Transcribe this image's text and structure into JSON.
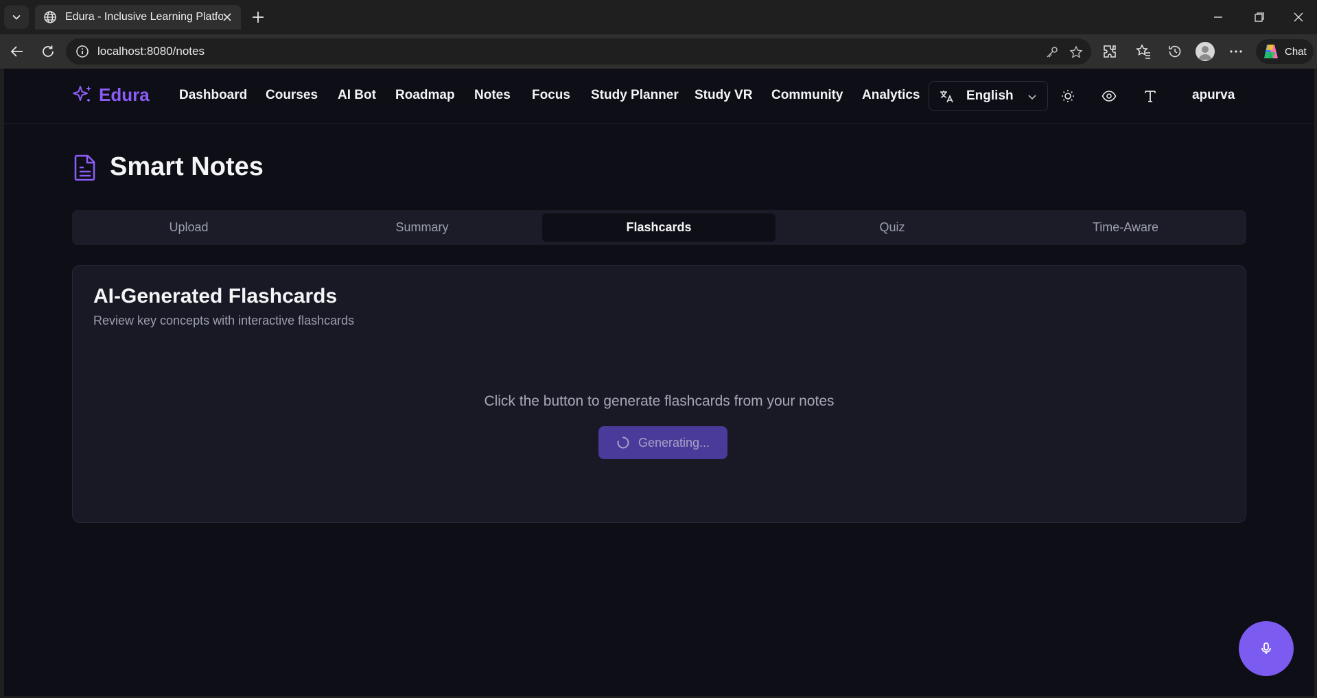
{
  "browser": {
    "tab_title": "Edura - Inclusive Learning Platform",
    "url": "localhost:8080/notes",
    "chat_label": "Chat"
  },
  "header": {
    "logo_text": "Edura",
    "nav": [
      "Dashboard",
      "Courses",
      "AI Bot",
      "Roadmap",
      "Notes",
      "Focus",
      "Study Planner",
      "Study VR",
      "Community",
      "Analytics"
    ],
    "language": "English",
    "user": "apurva"
  },
  "page": {
    "title": "Smart Notes",
    "tabs": [
      "Upload",
      "Summary",
      "Flashcards",
      "Quiz",
      "Time-Aware"
    ],
    "active_tab": "Flashcards"
  },
  "card": {
    "title": "AI-Generated Flashcards",
    "subtitle": "Review key concepts with interactive flashcards",
    "prompt": "Click the button to generate flashcards from your notes",
    "button_label": "Generating..."
  },
  "colors": {
    "brand": "#8b5cf6",
    "page_bg": "#0d0e16",
    "card_bg": "#181925",
    "button_bg": "#4a3a99",
    "fab_bg": "#7c5cf0"
  }
}
